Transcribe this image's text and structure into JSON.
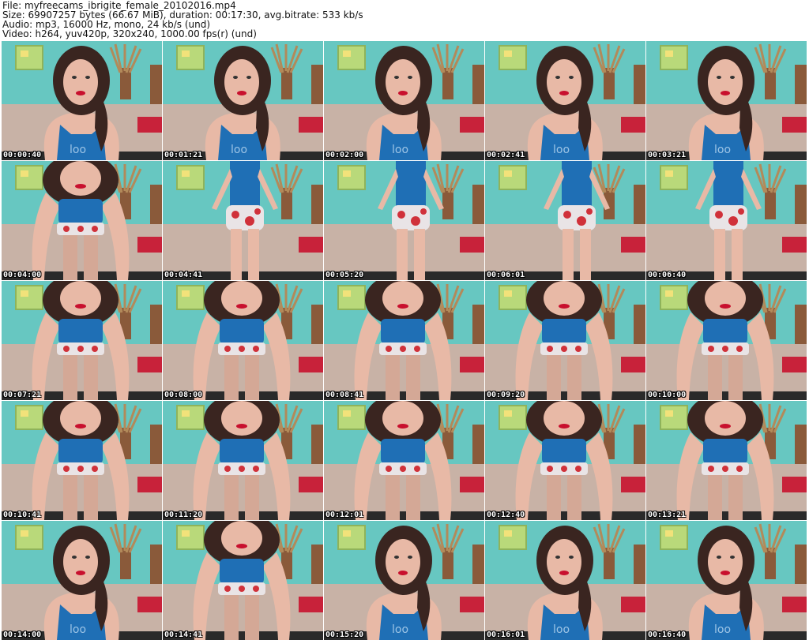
{
  "header": {
    "file_line": "File: myfreecams_ibrigite_female_20102016.mp4",
    "size_line": "Size: 69907257 bytes (66.67 MiB), duration: 00:17:30, avg.bitrate: 533 kb/s",
    "audio_line": "Audio: mp3, 16000 Hz, mono, 24 kb/s (und)",
    "video_line": "Video: h264, yuv420p, 320x240, 1000.00 fps(r) (und)"
  },
  "thumbnails": [
    {
      "timestamp": "00:00:40",
      "scene": "portrait"
    },
    {
      "timestamp": "00:01:21",
      "scene": "portrait"
    },
    {
      "timestamp": "00:02:00",
      "scene": "portrait"
    },
    {
      "timestamp": "00:02:41",
      "scene": "portrait"
    },
    {
      "timestamp": "00:03:21",
      "scene": "portrait"
    },
    {
      "timestamp": "00:04:00",
      "scene": "leaning"
    },
    {
      "timestamp": "00:04:41",
      "scene": "standing"
    },
    {
      "timestamp": "00:05:20",
      "scene": "standing"
    },
    {
      "timestamp": "00:06:01",
      "scene": "standing"
    },
    {
      "timestamp": "00:06:40",
      "scene": "standing"
    },
    {
      "timestamp": "00:07:21",
      "scene": "leaning"
    },
    {
      "timestamp": "00:08:00",
      "scene": "leaning"
    },
    {
      "timestamp": "00:08:41",
      "scene": "leaning"
    },
    {
      "timestamp": "00:09:20",
      "scene": "leaning"
    },
    {
      "timestamp": "00:10:00",
      "scene": "leaning"
    },
    {
      "timestamp": "00:10:41",
      "scene": "leaning"
    },
    {
      "timestamp": "00:11:20",
      "scene": "leaning"
    },
    {
      "timestamp": "00:12:01",
      "scene": "leaning"
    },
    {
      "timestamp": "00:12:40",
      "scene": "leaning"
    },
    {
      "timestamp": "00:13:21",
      "scene": "leaning"
    },
    {
      "timestamp": "00:14:00",
      "scene": "portrait"
    },
    {
      "timestamp": "00:14:41",
      "scene": "leaning"
    },
    {
      "timestamp": "00:15:20",
      "scene": "portrait"
    },
    {
      "timestamp": "00:16:01",
      "scene": "portrait"
    },
    {
      "timestamp": "00:16:40",
      "scene": "portrait"
    }
  ],
  "colors": {
    "wall": "#67c7c1",
    "shelf": "#b9d97a",
    "sofa": "#c8b2a6",
    "top": "#1f6fb5",
    "skin": "#e8b9a6",
    "hair": "#3a2520",
    "shorts": "#e9e4e6",
    "shorts_print": "#d0313a",
    "plant": "#8a5a3a"
  }
}
